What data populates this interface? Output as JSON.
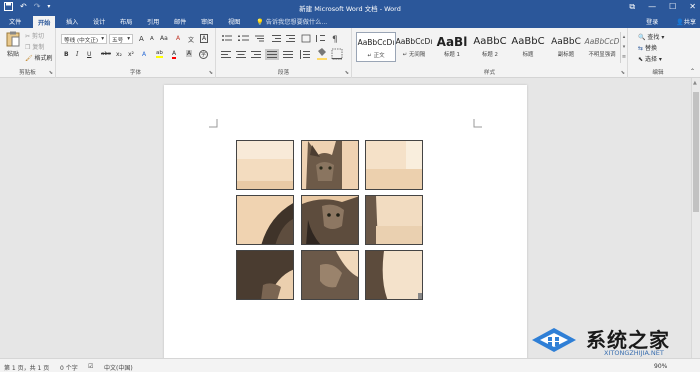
{
  "titlebar": {
    "title": "新建 Microsoft Word 文档 - Word",
    "undo_glyph": "↶",
    "redo_glyph": "↷",
    "restore_glyph": "⧉",
    "minimize_glyph": "—",
    "maximize_glyph": "☐",
    "close_glyph": "✕"
  },
  "tabs": [
    "文件",
    "开始",
    "插入",
    "设计",
    "布局",
    "引用",
    "邮件",
    "审阅",
    "视图"
  ],
  "active_tab": "开始",
  "tell_me": "告诉我您想要做什么...",
  "login": "登录",
  "share": "共享",
  "ribbon": {
    "clipboard": {
      "paste": "粘贴",
      "cut": "剪切",
      "copy": "复制",
      "format_painter": "格式刷",
      "label": "剪贴板"
    },
    "font": {
      "font_name": "等线 (中文正)",
      "font_size": "五号",
      "grow": "A",
      "shrink": "A",
      "case": "Aa",
      "clear": "A",
      "phonetic": "文",
      "border": "A",
      "bold": "B",
      "italic": "I",
      "underline": "U",
      "strike": "abc",
      "subscript": "x₂",
      "superscript": "x²",
      "effects": "A",
      "highlight": "ab",
      "color": "A",
      "shade": "A",
      "enclose": "字",
      "label": "字体"
    },
    "paragraph": {
      "label": "段落"
    },
    "styles": {
      "items": [
        {
          "sample": "AaBbCcDı",
          "name": "↵ 正文"
        },
        {
          "sample": "AaBbCcDı",
          "name": "↵ 无间隔"
        },
        {
          "sample": "AaBl",
          "name": "标题 1"
        },
        {
          "sample": "AaBbC",
          "name": "标题 2"
        },
        {
          "sample": "AaBbC",
          "name": "标题"
        },
        {
          "sample": "AaBbC",
          "name": "副标题"
        },
        {
          "sample": "AaBbCcD",
          "name": "不明显强调"
        }
      ],
      "label": "样式"
    },
    "editing": {
      "find": "查找",
      "replace": "替换",
      "select": "选择",
      "label": "编辑"
    }
  },
  "status": {
    "page": "第 1 页，共 1 页",
    "words": "0 个字",
    "language": "中文(中国)",
    "zoom": "90%"
  },
  "watermark": {
    "brand": "系统之家",
    "url": "XITONGZHIJIA.NET"
  },
  "colors": {
    "accent": "#2b579a",
    "highlight": "#ffff00",
    "font_color": "#ff0000"
  }
}
